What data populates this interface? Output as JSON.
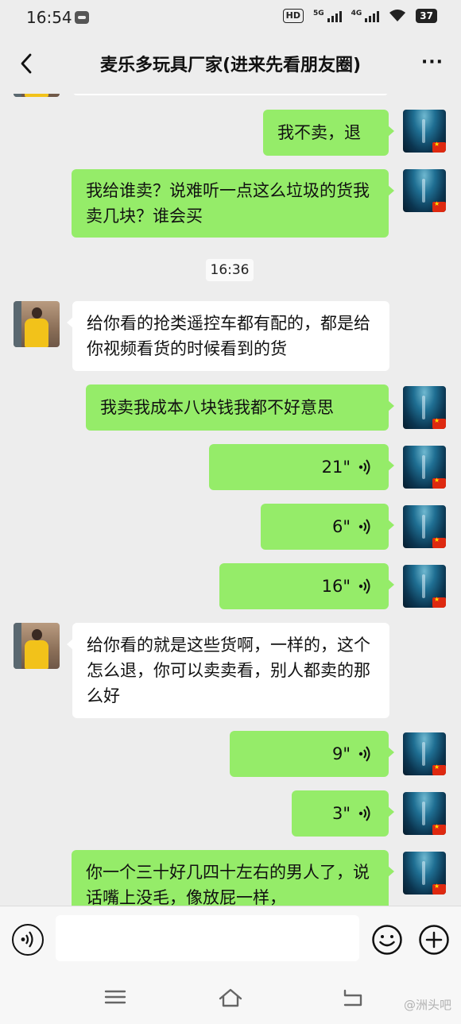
{
  "status_bar": {
    "time": "16:54",
    "hd_label": "HD",
    "net1": "5G",
    "net2": "4G",
    "battery": "37"
  },
  "header": {
    "title": "麦乐多玩具厂家(进来先看朋友圈)"
  },
  "messages": [
    {
      "type": "text",
      "from": "self",
      "text": "我不卖，退"
    },
    {
      "type": "text",
      "from": "self",
      "text": "我给谁卖？说难听一点这么垃圾的货我卖几块？谁会买"
    },
    {
      "type": "time",
      "text": "16:36"
    },
    {
      "type": "text",
      "from": "contact",
      "text": "给你看的抢类遥控车都有配的，都是给你视频看货的时候看到的货"
    },
    {
      "type": "text",
      "from": "self",
      "text": "我卖我成本八块钱我都不好意思"
    },
    {
      "type": "voice",
      "from": "self",
      "duration": "21\""
    },
    {
      "type": "voice",
      "from": "self",
      "duration": "6\""
    },
    {
      "type": "voice",
      "from": "self",
      "duration": "16\""
    },
    {
      "type": "text",
      "from": "contact",
      "text": "给你看的就是这些货啊，一样的，这个怎么退，你可以卖卖看，别人都卖的那么好"
    },
    {
      "type": "voice",
      "from": "self",
      "duration": "9\""
    },
    {
      "type": "voice",
      "from": "self",
      "duration": "3\""
    },
    {
      "type": "text",
      "from": "self",
      "text": "你一个三十好几四十左右的男人了，说话嘴上没毛，像放屁一样，"
    }
  ],
  "input": {
    "value": ""
  },
  "watermark": "@洲头吧",
  "colors": {
    "sent_bubble": "#95ec69",
    "recv_bubble": "#ffffff",
    "background": "#ededed"
  },
  "icons": [
    "back-icon",
    "more-icon",
    "voice-wave-icon",
    "voice-toggle-icon",
    "emoji-icon",
    "plus-icon",
    "menu-icon",
    "home-icon",
    "back-nav-icon"
  ]
}
